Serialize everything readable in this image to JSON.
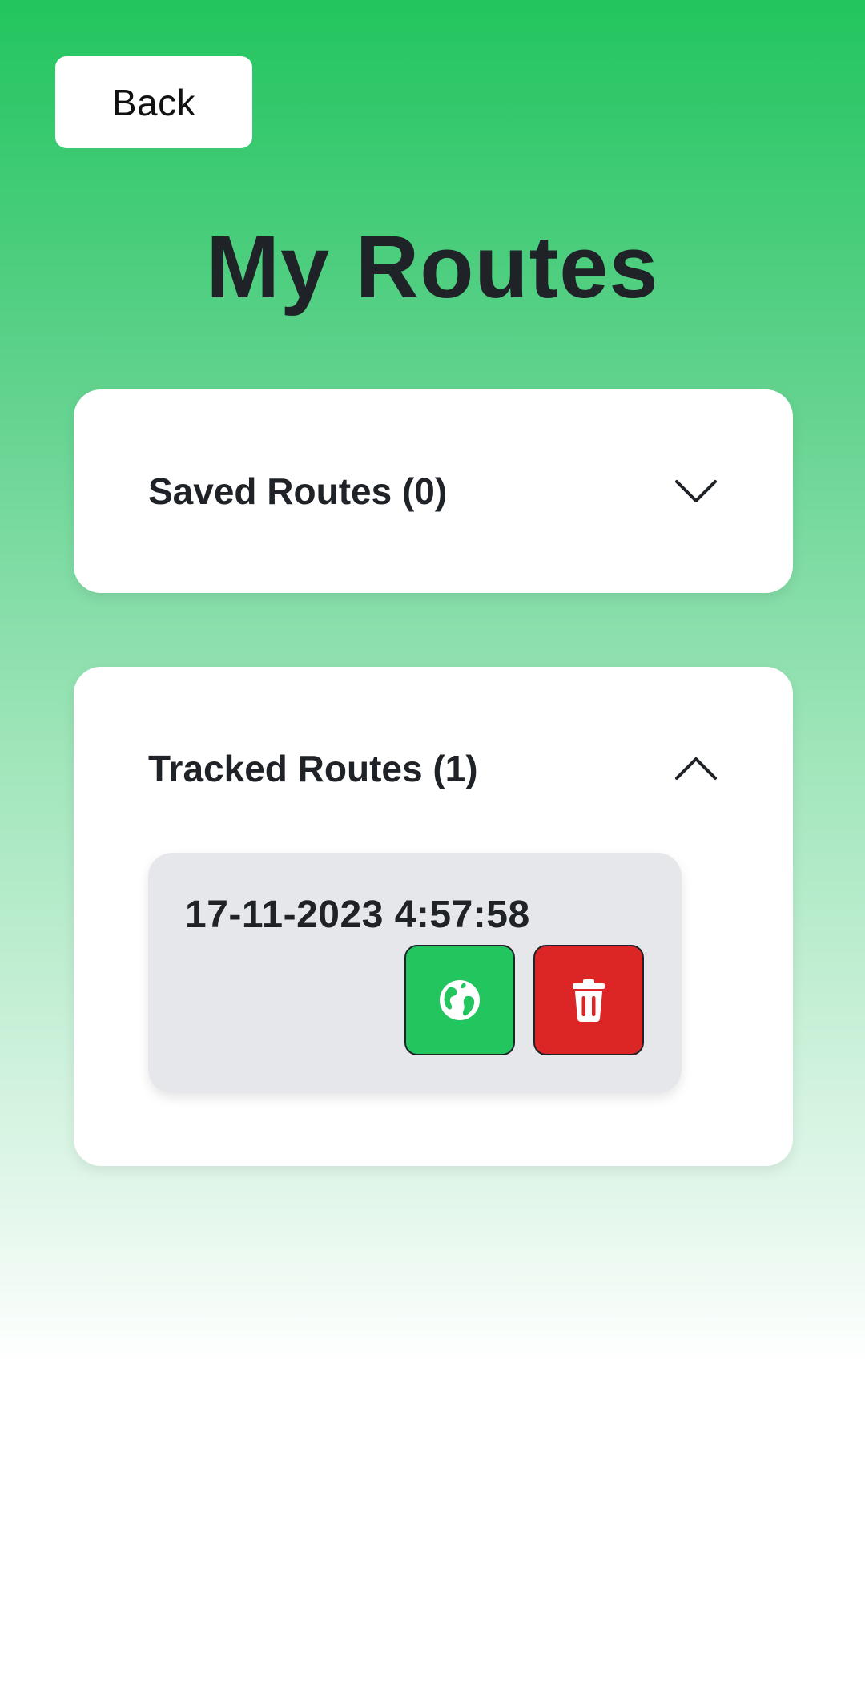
{
  "header": {
    "back_label": "Back",
    "title": "My Routes"
  },
  "sections": {
    "saved": {
      "label": "Saved Routes (0)",
      "expanded": false,
      "icon": "chevron-down-icon"
    },
    "tracked": {
      "label": "Tracked Routes (1)",
      "expanded": true,
      "icon": "chevron-up-icon",
      "items": [
        {
          "date": "17-11-2023 4:57:58",
          "actions": [
            {
              "icon": "globe-icon",
              "color": "#22c55e"
            },
            {
              "icon": "trash-icon",
              "color": "#dc2626"
            }
          ]
        }
      ]
    }
  },
  "colors": {
    "accent": "#22c55e",
    "danger": "#dc2626",
    "text": "#1f2328",
    "item_bg": "#e5e7eb"
  }
}
